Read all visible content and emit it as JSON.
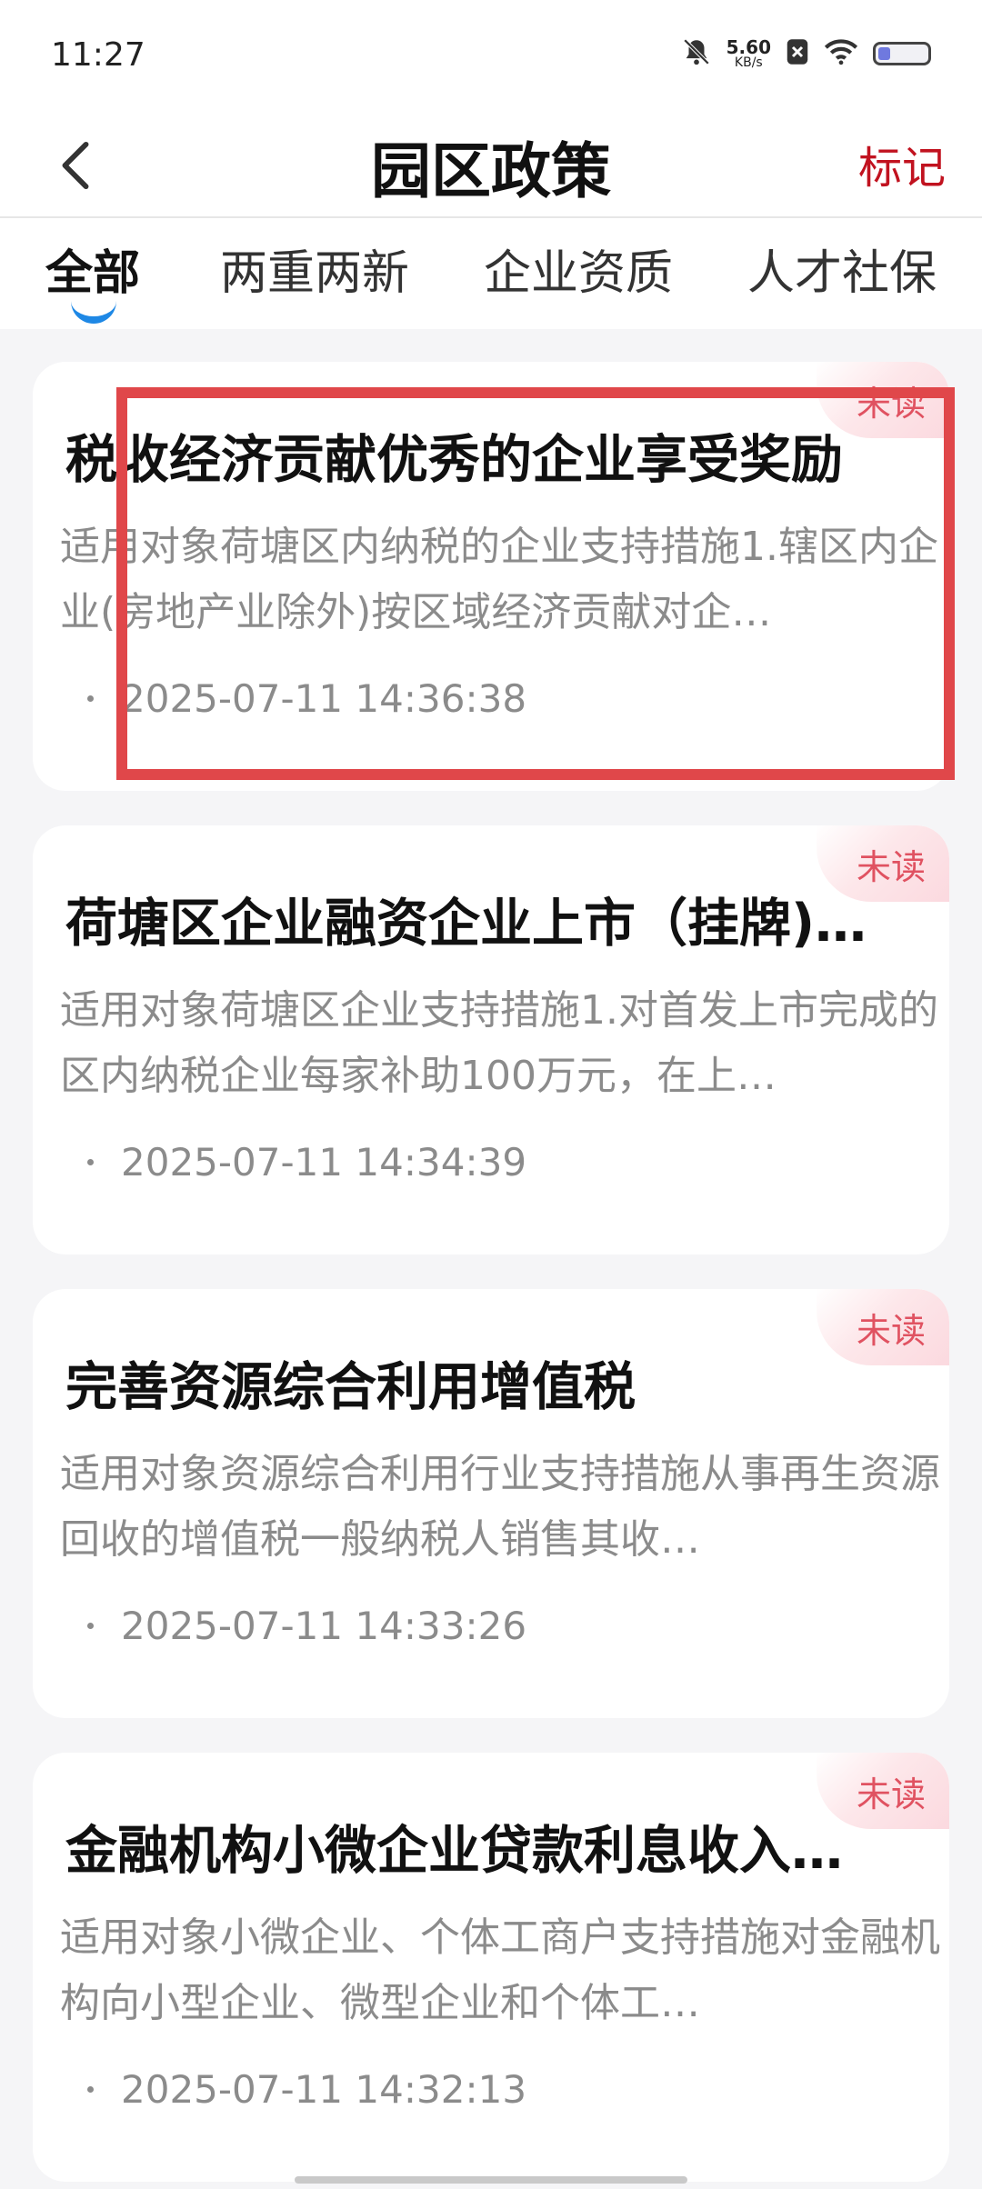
{
  "status": {
    "time": "11:27",
    "net_speed_value": "5.60",
    "net_speed_unit": "KB/s",
    "battery_level": 0.25
  },
  "header": {
    "title": "园区政策",
    "mark_label": "标记"
  },
  "tabs": [
    {
      "label": "全部"
    },
    {
      "label": "两重两新"
    },
    {
      "label": "企业资质"
    },
    {
      "label": "人才社保"
    }
  ],
  "cards": [
    {
      "badge": "未读",
      "title": "税收经济贡献优秀的企业享受奖励",
      "summary": "适用对象荷塘区内纳税的企业支持措施1.辖区内企业(房地产业除外)按区域经济贡献对企…",
      "date": "2025-07-11 14:36:38"
    },
    {
      "badge": "未读",
      "title": "荷塘区企业融资企业上市（挂牌)…",
      "summary": "适用对象荷塘区企业支持措施1.对首发上市完成的区内纳税企业每家补助100万元，在上…",
      "date": "2025-07-11 14:34:39"
    },
    {
      "badge": "未读",
      "title": "完善资源综合利用增值税",
      "summary": "适用对象资源综合利用行业支持措施从事再生资源回收的增值税一般纳税人销售其收…",
      "date": "2025-07-11 14:33:26"
    },
    {
      "badge": "未读",
      "title": "金融机构小微企业贷款利息收入…",
      "summary": "适用对象小微企业、个体工商户支持措施对金融机构向小型企业、微型企业和个体工…",
      "date": "2025-07-11 14:32:13"
    }
  ],
  "colors": {
    "accent_red": "#c1121f",
    "badge_text": "#e05261",
    "tab_indicator": "#1e88e5",
    "highlight_box": "#e0474a",
    "page_bg": "#f5f5f7"
  }
}
